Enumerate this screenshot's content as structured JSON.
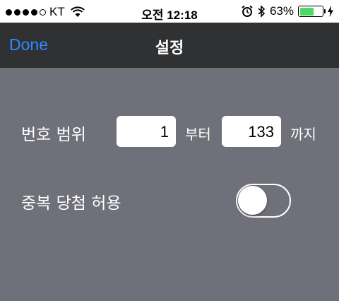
{
  "status_bar": {
    "carrier": "KT",
    "time": "오전 12:18",
    "battery_percent": "63%",
    "battery_level": 0.63,
    "signal_bars": 4,
    "icons": [
      "wifi-icon",
      "alarm-icon",
      "bluetooth-icon",
      "battery-icon",
      "charging-icon"
    ]
  },
  "nav": {
    "done_label": "Done",
    "title": "설정"
  },
  "range": {
    "label": "번호 범위",
    "from_value": "1",
    "from_suffix": "부터",
    "to_value": "133",
    "to_suffix": "까지"
  },
  "duplicate": {
    "label": "중복 당첨 허용",
    "enabled": false
  },
  "colors": {
    "background": "#6f7079",
    "nav_bar": "#303133",
    "accent": "#2e8cff",
    "battery_fill": "#4cd964"
  }
}
